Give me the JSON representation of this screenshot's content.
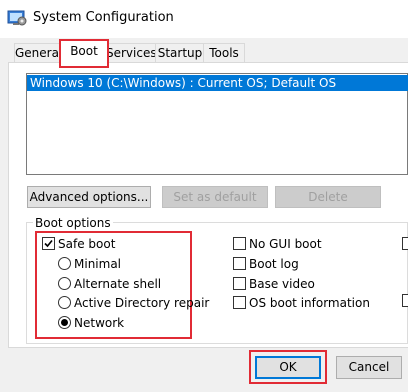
{
  "window": {
    "title": "System Configuration",
    "icon": "msconfig-icon"
  },
  "tabs": [
    {
      "label": "General",
      "active": false
    },
    {
      "label": "Boot",
      "active": true
    },
    {
      "label": "Services",
      "active": false
    },
    {
      "label": "Startup",
      "active": false
    },
    {
      "label": "Tools",
      "active": false
    }
  ],
  "os_list": {
    "items": [
      {
        "label": "Windows 10 (C:\\Windows) : Current OS; Default OS",
        "selected": true
      }
    ]
  },
  "buttons": {
    "advanced": "Advanced options...",
    "set_default": "Set as default",
    "delete": "Delete",
    "ok": "OK",
    "cancel": "Cancel"
  },
  "boot_options": {
    "label": "Boot options",
    "safe_boot": {
      "label": "Safe boot",
      "checked": true
    },
    "radios": [
      {
        "label": "Minimal",
        "selected": false
      },
      {
        "label": "Alternate shell",
        "selected": false
      },
      {
        "label": "Active Directory repair",
        "selected": false
      },
      {
        "label": "Network",
        "selected": true
      }
    ],
    "right_checks": [
      {
        "label": "No GUI boot",
        "checked": false
      },
      {
        "label": "Boot log",
        "checked": false
      },
      {
        "label": "Base video",
        "checked": false
      },
      {
        "label": "OS boot information",
        "checked": false
      }
    ]
  },
  "colors": {
    "selection": "#0078d7",
    "highlight": "#e12b35",
    "button": "#e1e1e1"
  }
}
